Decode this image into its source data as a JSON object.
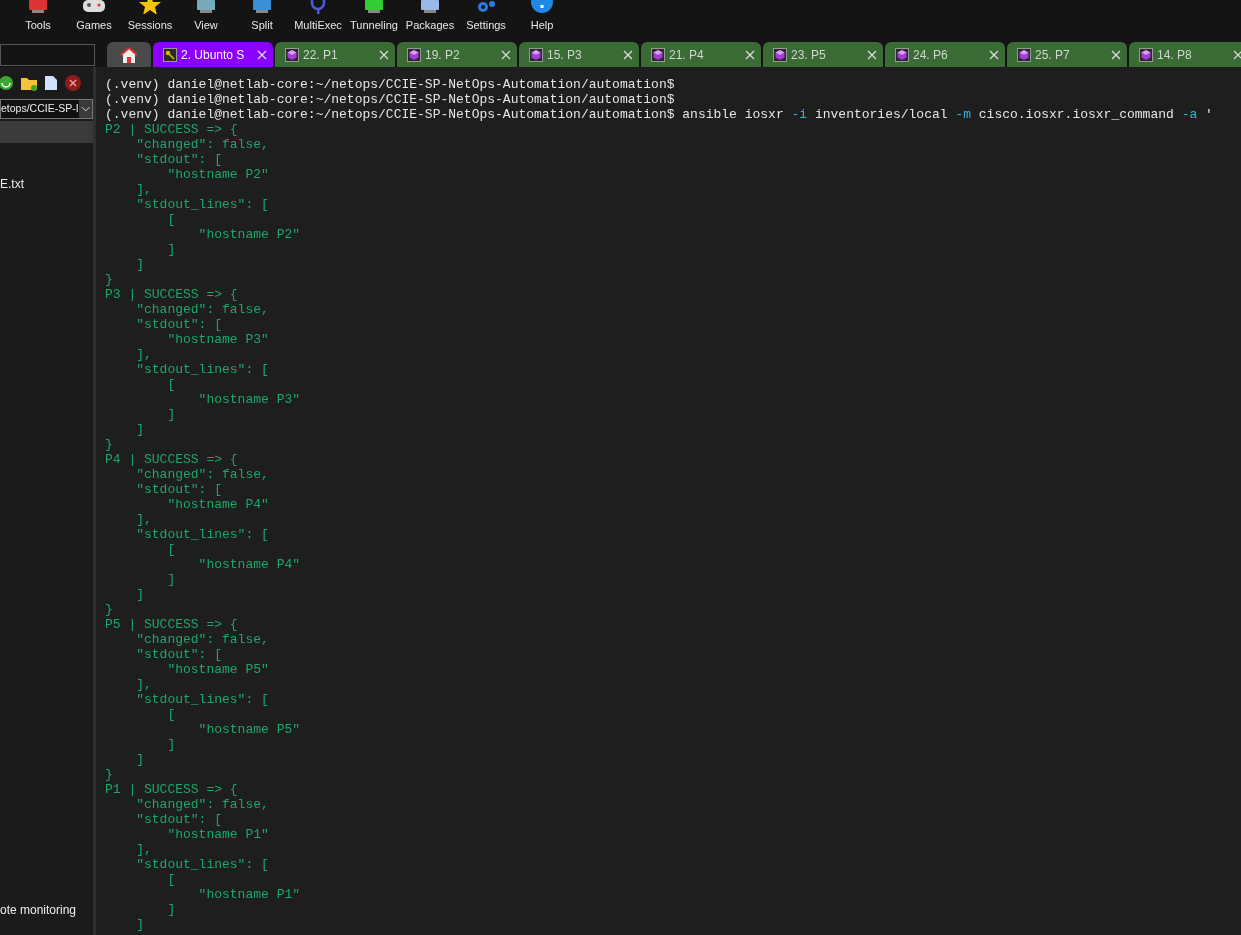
{
  "toolbar": [
    {
      "label": "Tools",
      "kind": "tools"
    },
    {
      "label": "Games",
      "kind": "games"
    },
    {
      "label": "Sessions",
      "kind": "sessions"
    },
    {
      "label": "View",
      "kind": "view"
    },
    {
      "label": "Split",
      "kind": "split"
    },
    {
      "label": "MultiExec",
      "kind": "multiexec"
    },
    {
      "label": "Tunneling",
      "kind": "tunneling"
    },
    {
      "label": "Packages",
      "kind": "packages"
    },
    {
      "label": "Settings",
      "kind": "settings"
    },
    {
      "label": "Help",
      "kind": "help"
    }
  ],
  "tabs": [
    {
      "kind": "home",
      "selected": false
    },
    {
      "kind": "ssh",
      "label": "2. Ubunto S",
      "selected": true
    },
    {
      "kind": "device",
      "label": "22. P1",
      "selected": false
    },
    {
      "kind": "device",
      "label": "19. P2",
      "selected": false
    },
    {
      "kind": "device",
      "label": "15. P3",
      "selected": false
    },
    {
      "kind": "device",
      "label": "21. P4",
      "selected": false
    },
    {
      "kind": "device",
      "label": "23. P5",
      "selected": false
    },
    {
      "kind": "device",
      "label": "24. P6",
      "selected": false
    },
    {
      "kind": "device",
      "label": "25. P7",
      "selected": false
    },
    {
      "kind": "device",
      "label": "14. P8",
      "selected": false
    }
  ],
  "sidebar": {
    "path": "etops/CCIE-SP-I",
    "files": [
      "E.txt"
    ],
    "bottom_items": [
      "ote monitoring"
    ]
  },
  "terminal": {
    "lines": [
      {
        "kind": "prompt",
        "prompt": "(.venv) daniel@netlab-core:~/netops/CCIE-SP-NetOps-Automation/automation$"
      },
      {
        "kind": "prompt",
        "prompt": "(.venv) daniel@netlab-core:~/netops/CCIE-SP-NetOps-Automation/automation$"
      },
      {
        "kind": "prompt",
        "prompt": "(.venv) daniel@netlab-core:~/netops/CCIE-SP-NetOps-Automation/automation$",
        "command": [
          {
            "kind": "plain",
            "text": " ansible iosxr "
          },
          {
            "kind": "flag",
            "text": "-i"
          },
          {
            "kind": "plain",
            "text": " inventories/local "
          },
          {
            "kind": "flag",
            "text": "-m"
          },
          {
            "kind": "plain",
            "text": " cisco.iosxr.iosxr_command "
          },
          {
            "kind": "flag",
            "text": "-a"
          },
          {
            "kind": "plain",
            "text": " '"
          }
        ]
      },
      {
        "kind": "output",
        "text": "P2 | SUCCESS => {"
      },
      {
        "kind": "output",
        "text": "    \"changed\": false,"
      },
      {
        "kind": "output",
        "text": "    \"stdout\": ["
      },
      {
        "kind": "output",
        "text": "        \"hostname P2\""
      },
      {
        "kind": "output",
        "text": "    ],"
      },
      {
        "kind": "output",
        "text": "    \"stdout_lines\": ["
      },
      {
        "kind": "output",
        "text": "        ["
      },
      {
        "kind": "output",
        "text": "            \"hostname P2\""
      },
      {
        "kind": "output",
        "text": "        ]"
      },
      {
        "kind": "output",
        "text": "    ]"
      },
      {
        "kind": "output",
        "text": "}"
      },
      {
        "kind": "output",
        "text": "P3 | SUCCESS => {"
      },
      {
        "kind": "output",
        "text": "    \"changed\": false,"
      },
      {
        "kind": "output",
        "text": "    \"stdout\": ["
      },
      {
        "kind": "output",
        "text": "        \"hostname P3\""
      },
      {
        "kind": "output",
        "text": "    ],"
      },
      {
        "kind": "output",
        "text": "    \"stdout_lines\": ["
      },
      {
        "kind": "output",
        "text": "        ["
      },
      {
        "kind": "output",
        "text": "            \"hostname P3\""
      },
      {
        "kind": "output",
        "text": "        ]"
      },
      {
        "kind": "output",
        "text": "    ]"
      },
      {
        "kind": "output",
        "text": "}"
      },
      {
        "kind": "output",
        "text": "P4 | SUCCESS => {"
      },
      {
        "kind": "output",
        "text": "    \"changed\": false,"
      },
      {
        "kind": "output",
        "text": "    \"stdout\": ["
      },
      {
        "kind": "output",
        "text": "        \"hostname P4\""
      },
      {
        "kind": "output",
        "text": "    ],"
      },
      {
        "kind": "output",
        "text": "    \"stdout_lines\": ["
      },
      {
        "kind": "output",
        "text": "        ["
      },
      {
        "kind": "output",
        "text": "            \"hostname P4\""
      },
      {
        "kind": "output",
        "text": "        ]"
      },
      {
        "kind": "output",
        "text": "    ]"
      },
      {
        "kind": "output",
        "text": "}"
      },
      {
        "kind": "output",
        "text": "P5 | SUCCESS => {"
      },
      {
        "kind": "output",
        "text": "    \"changed\": false,"
      },
      {
        "kind": "output",
        "text": "    \"stdout\": ["
      },
      {
        "kind": "output",
        "text": "        \"hostname P5\""
      },
      {
        "kind": "output",
        "text": "    ],"
      },
      {
        "kind": "output",
        "text": "    \"stdout_lines\": ["
      },
      {
        "kind": "output",
        "text": "        ["
      },
      {
        "kind": "output",
        "text": "            \"hostname P5\""
      },
      {
        "kind": "output",
        "text": "        ]"
      },
      {
        "kind": "output",
        "text": "    ]"
      },
      {
        "kind": "output",
        "text": "}"
      },
      {
        "kind": "output",
        "text": "P1 | SUCCESS => {"
      },
      {
        "kind": "output",
        "text": "    \"changed\": false,"
      },
      {
        "kind": "output",
        "text": "    \"stdout\": ["
      },
      {
        "kind": "output",
        "text": "        \"hostname P1\""
      },
      {
        "kind": "output",
        "text": "    ],"
      },
      {
        "kind": "output",
        "text": "    \"stdout_lines\": ["
      },
      {
        "kind": "output",
        "text": "        ["
      },
      {
        "kind": "output",
        "text": "            \"hostname P1\""
      },
      {
        "kind": "output",
        "text": "        ]"
      },
      {
        "kind": "output",
        "text": "    ]"
      }
    ]
  }
}
